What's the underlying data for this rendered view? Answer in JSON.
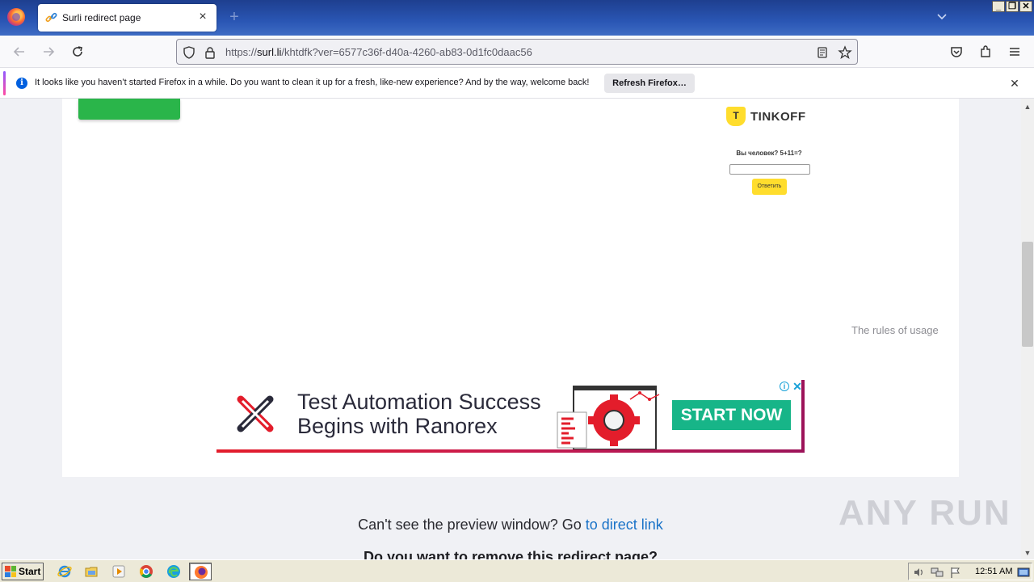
{
  "browser": {
    "tab": {
      "title": "Surli redirect page"
    },
    "url": {
      "prefix": "https://",
      "host": "surl.li",
      "path": "/khtdfk?ver=6577c36f-d40a-4260-ab83-0d1fc0daac56"
    },
    "window_buttons": [
      "_",
      "❐",
      "✕"
    ],
    "notification": {
      "text": "It looks like you haven’t started Firefox in a while. Do you want to clean it up for a fresh, like-new experience? And by the way, welcome back!",
      "button_label": "Refresh Firefox…"
    }
  },
  "page": {
    "tinkoff": {
      "brand": "TINKOFF",
      "logo_letter": "T",
      "captcha_question": "Вы человек? 5+11=?",
      "answer_button": "Ответить"
    },
    "rules_link": "The rules of usage",
    "ad": {
      "headline_line1": "Test Automation Success",
      "headline_line2": "Begins with Ranorex",
      "cta": "START NOW",
      "info": "i",
      "close": "✕"
    },
    "preview_text": "Can't see the preview window? Go ",
    "preview_link": "to direct link",
    "remove_text": "Do you want to remove this redirect page?"
  },
  "watermark": "ANY RUN",
  "taskbar": {
    "start_label": "Start",
    "clock": "12:51 AM",
    "pinned": [
      "internet-explorer-icon",
      "folder-icon",
      "media-player-icon",
      "chrome-icon",
      "edge-icon",
      "firefox-icon"
    ]
  },
  "colors": {
    "accent_green": "#2ab54a",
    "tinkoff_yellow": "#ffdd2d",
    "ad_cta": "#17b588",
    "link_blue": "#1a73c8"
  }
}
